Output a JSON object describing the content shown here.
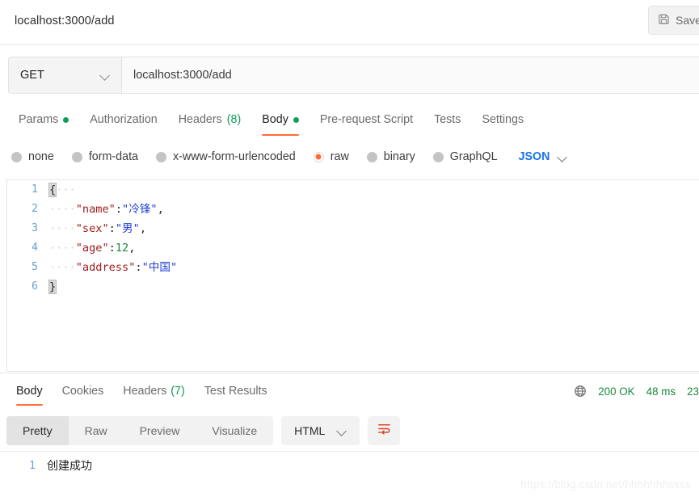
{
  "window": {
    "tab_title": "localhost:3000/add",
    "save_label": "Save",
    "save_icon": "floppy-disk-icon"
  },
  "request": {
    "method": "GET",
    "method_chevron": "chevron-down-icon",
    "url": "localhost:3000/add",
    "tabs": [
      {
        "label": "Params",
        "indicator": "dot",
        "active": false
      },
      {
        "label": "Authorization",
        "indicator": "",
        "active": false
      },
      {
        "label": "Headers",
        "count": "(8)",
        "active": false
      },
      {
        "label": "Body",
        "indicator": "dot",
        "active": true
      },
      {
        "label": "Pre-request Script",
        "indicator": "",
        "active": false
      },
      {
        "label": "Tests",
        "indicator": "",
        "active": false
      },
      {
        "label": "Settings",
        "indicator": "",
        "active": false
      }
    ],
    "body_types": [
      {
        "label": "none",
        "selected": false
      },
      {
        "label": "form-data",
        "selected": false
      },
      {
        "label": "x-www-form-urlencoded",
        "selected": false
      },
      {
        "label": "raw",
        "selected": true
      },
      {
        "label": "binary",
        "selected": false
      },
      {
        "label": "GraphQL",
        "selected": false
      }
    ],
    "raw_format": "JSON",
    "raw_format_chevron": "chevron-down-icon",
    "editor_lines": [
      {
        "n": "1",
        "segments": [
          {
            "t": "{",
            "c": "brace-hl"
          },
          {
            "t": "···",
            "c": "tok-ws"
          }
        ]
      },
      {
        "n": "2",
        "segments": [
          {
            "t": "····",
            "c": "tok-ws"
          },
          {
            "t": "\"name\"",
            "c": "tok-key"
          },
          {
            "t": ":",
            "c": "tok-punc"
          },
          {
            "t": "\"冷锋\"",
            "c": "tok-str"
          },
          {
            "t": ",",
            "c": "tok-punc"
          }
        ]
      },
      {
        "n": "3",
        "segments": [
          {
            "t": "····",
            "c": "tok-ws"
          },
          {
            "t": "\"sex\"",
            "c": "tok-key"
          },
          {
            "t": ":",
            "c": "tok-punc"
          },
          {
            "t": "\"男\"",
            "c": "tok-str"
          },
          {
            "t": ",",
            "c": "tok-punc"
          }
        ]
      },
      {
        "n": "4",
        "segments": [
          {
            "t": "····",
            "c": "tok-ws"
          },
          {
            "t": "\"age\"",
            "c": "tok-key"
          },
          {
            "t": ":",
            "c": "tok-punc"
          },
          {
            "t": "12",
            "c": "tok-num"
          },
          {
            "t": ",",
            "c": "tok-punc"
          }
        ]
      },
      {
        "n": "5",
        "segments": [
          {
            "t": "····",
            "c": "tok-ws"
          },
          {
            "t": "\"address\"",
            "c": "tok-key"
          },
          {
            "t": ":",
            "c": "tok-punc"
          },
          {
            "t": "\"中国\"",
            "c": "tok-str"
          }
        ]
      },
      {
        "n": "6",
        "segments": [
          {
            "t": "}",
            "c": "brace-hl"
          }
        ]
      }
    ]
  },
  "response": {
    "tabs": [
      {
        "label": "Body",
        "count": "",
        "active": true
      },
      {
        "label": "Cookies",
        "count": "",
        "active": false
      },
      {
        "label": "Headers",
        "count": "(7)",
        "active": false
      },
      {
        "label": "Test Results",
        "count": "",
        "active": false
      }
    ],
    "globe_icon": "globe-icon",
    "status": "200 OK",
    "time": "48 ms",
    "size": "23",
    "view_modes": [
      {
        "label": "Pretty",
        "active": true
      },
      {
        "label": "Raw",
        "active": false
      },
      {
        "label": "Preview",
        "active": false
      },
      {
        "label": "Visualize",
        "active": false
      }
    ],
    "format": "HTML",
    "format_chevron": "chevron-down-icon",
    "wrap_icon": "word-wrap-icon",
    "body_lines": [
      {
        "n": "1",
        "text": "创建成功"
      }
    ]
  },
  "watermark": "https://blog.csdn.net/hhhhhhhssss",
  "colors": {
    "accent_orange": "#ff6c37",
    "status_green": "#1a8a3a",
    "json_blue": "#1a73e8",
    "key_maroon": "#a01b1b",
    "string_blue": "#1f3fd6"
  }
}
